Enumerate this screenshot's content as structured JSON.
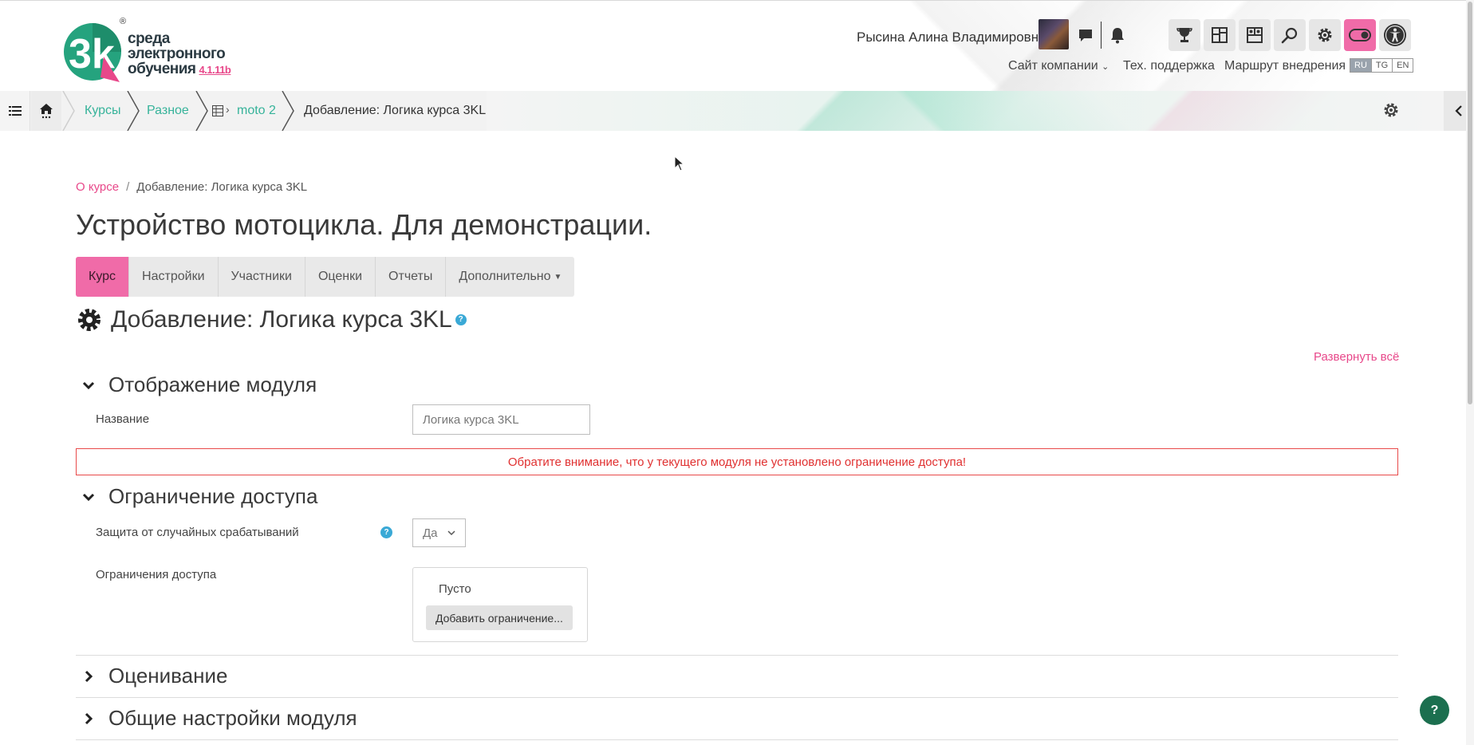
{
  "colors": {
    "accent_pink": "#f06ba8",
    "link_pink": "#e8488a",
    "crumb_green": "#36b39a",
    "warning_red": "#e03030",
    "help_blue": "#3aa9d6",
    "fab_green": "#1c6f4f"
  },
  "logo": {
    "line1": "среда",
    "line2": "электронного",
    "line3": "обучения",
    "version": "4.1.11b",
    "reg": "®"
  },
  "header": {
    "user_name": "Рысина Алина Владимировна",
    "links": {
      "company_site": "Сайт компании",
      "support": "Тех. поддержка",
      "route": "Маршрут внедрения"
    },
    "languages": [
      "RU",
      "TG",
      "EN"
    ],
    "active_language": "RU",
    "icons": [
      "messages-icon",
      "bell-icon",
      "trophy-icon",
      "dashboard-icon",
      "gallery-icon",
      "search-icon",
      "gear-icon",
      "toggle-icon",
      "accessibility-icon"
    ]
  },
  "breadcrumbs": {
    "items": [
      "Курсы",
      "Разное",
      "moto 2"
    ],
    "current": "Добавление: Логика курса 3KL"
  },
  "page": {
    "crumb_link": "О курсе",
    "crumb_sep": "/",
    "crumb_current": "Добавление: Логика курса 3KL",
    "title": "Устройство мотоцикла. Для демонстрации.",
    "tabs": [
      "Курс",
      "Настройки",
      "Участники",
      "Оценки",
      "Отчеты",
      "Дополнительно"
    ],
    "active_tab": "Курс",
    "section_title": "Добавление: Логика курса 3KL",
    "help_mark": "?",
    "expand_all": "Развернуть всё"
  },
  "form": {
    "display": {
      "heading": "Отображение модуля",
      "name_label": "Название",
      "name_value": "Логика курса 3KL"
    },
    "warning": "Обратите внимание, что у текущего модуля не установлено ограничение доступа!",
    "access": {
      "heading": "Ограничение доступа",
      "protect_label": "Защита от случайных срабатываний",
      "protect_value": "Да",
      "restrictions_label": "Ограничения доступа",
      "restrictions_empty": "Пусто",
      "add_restriction": "Добавить ограничение..."
    },
    "grading_heading": "Оценивание",
    "common_heading": "Общие настройки модуля"
  },
  "fab": {
    "label": "?"
  }
}
